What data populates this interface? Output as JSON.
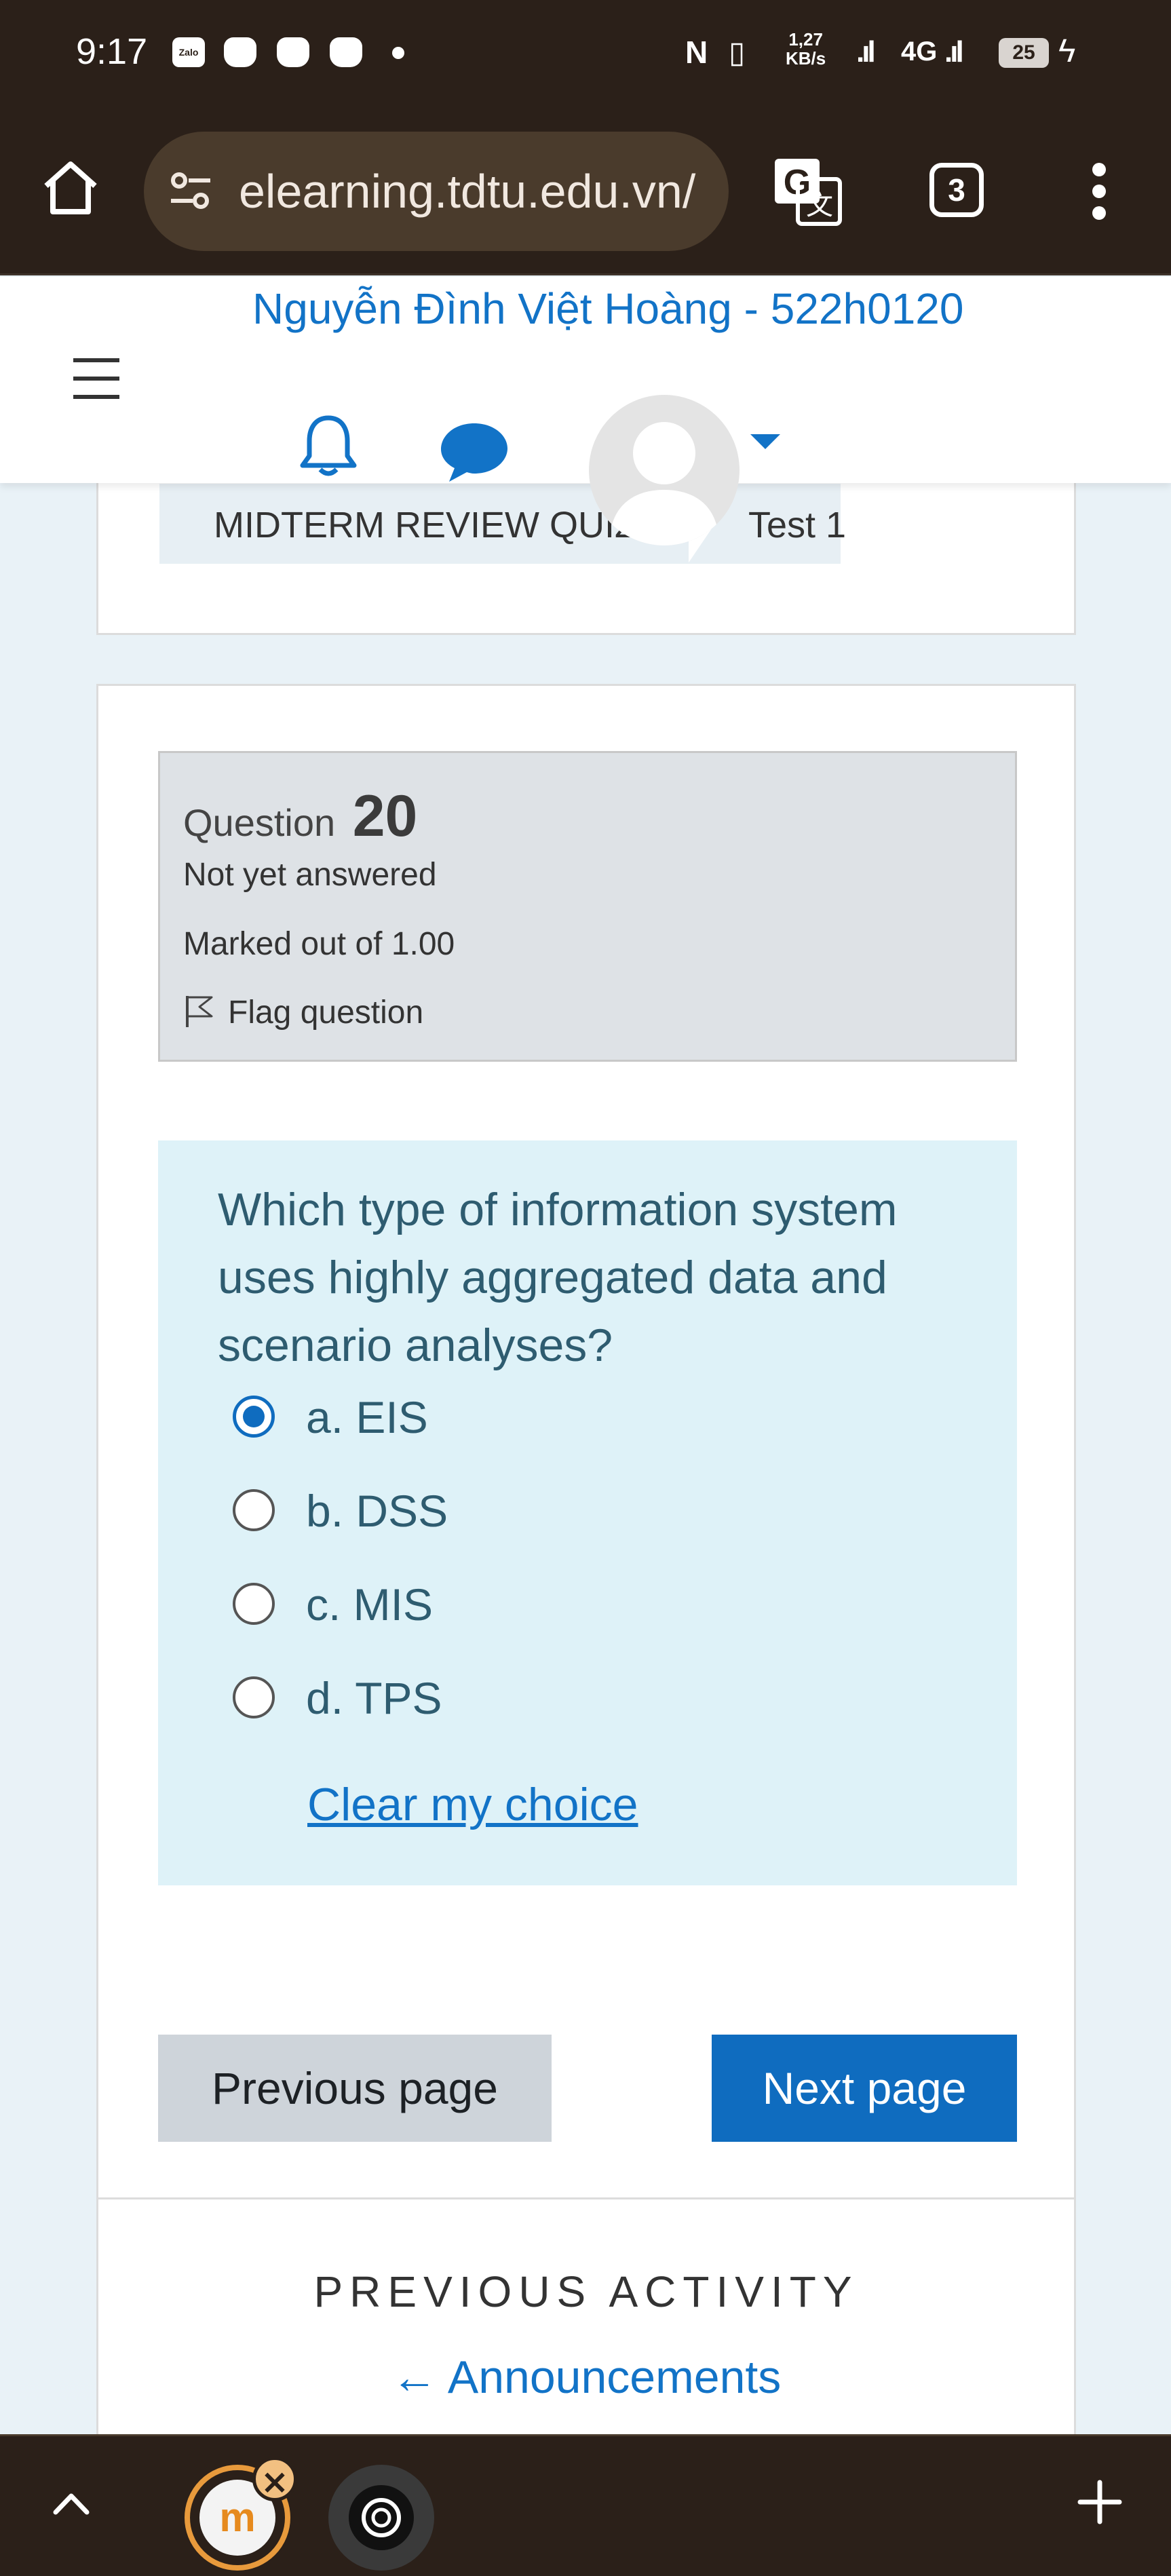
{
  "status_bar": {
    "time": "9:17",
    "zalo_label": "Zalo",
    "net_speed_value": "1,27",
    "net_speed_unit": "KB/s",
    "network": "4G",
    "battery": "25"
  },
  "browser": {
    "url": "elearning.tdtu.edu.vn/",
    "tab_count": "3"
  },
  "header": {
    "user_name": "Nguyễn Đình Việt Hoàng - 522h0120"
  },
  "breadcrumb": {
    "items": [
      "MIDTERM REVIEW QUIZ",
      "Test 1"
    ]
  },
  "question_info": {
    "label": "Question",
    "number": "20",
    "state": "Not yet answered",
    "marked": "Marked out of 1.00",
    "flag_label": "Flag question"
  },
  "question": {
    "text": "Which type of information system uses highly aggregated data and scenario analyses?",
    "options": [
      {
        "label": "a. EIS",
        "selected": true
      },
      {
        "label": "b. DSS",
        "selected": false
      },
      {
        "label": "c. MIS",
        "selected": false
      },
      {
        "label": "d. TPS",
        "selected": false
      }
    ],
    "clear_label": "Clear my choice"
  },
  "navigation": {
    "previous_label": "Previous page",
    "next_label": "Next page"
  },
  "previous_activity": {
    "heading": "PREVIOUS ACTIVITY",
    "link_text": "← Announcements"
  },
  "colors": {
    "accent": "#0f6cbf",
    "link": "#1273c7",
    "question_bg": "#def2f8",
    "chrome_bg": "#2b2019"
  }
}
